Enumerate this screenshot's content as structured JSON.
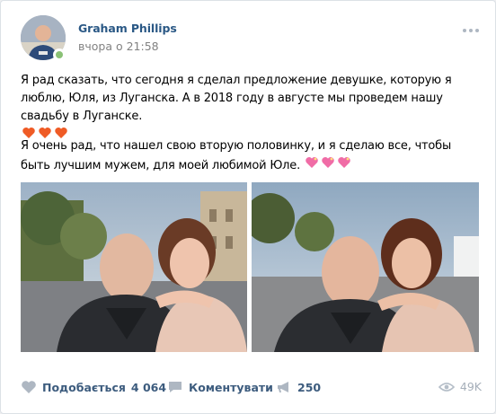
{
  "post": {
    "author": "Graham Phillips",
    "time": "вчора о 21:58",
    "paragraph1": "Я рад сказать, что сегодня я сделал предложение девушке, которую я люблю, Юля, из Луганска. А в 2018 году в августе мы проведем нашу свадьбу в Луганске.",
    "paragraph2": "Я очень рад, что нашел свою вторую половинку, и я сделаю все, чтобы быть лучшим мужем, для моей любимой Юле.",
    "paragraph1_emoji": [
      "orange-heart-icon",
      "orange-heart-icon",
      "orange-heart-icon"
    ],
    "paragraph2_emoji": [
      "sparkling-heart-icon",
      "sparkling-heart-icon",
      "sparkling-heart-icon"
    ]
  },
  "photos": [
    "photo-selfie-city-street",
    "photo-selfie-evening-square"
  ],
  "actions": {
    "like_label": "Подобається",
    "like_count": "4 064",
    "comment_label": "Коментувати",
    "share_count": "250",
    "views": "49K"
  },
  "colors": {
    "link": "#2a5885",
    "muted": "#828282",
    "online": "#8ac176",
    "action_icon": "#aeb7c2"
  }
}
